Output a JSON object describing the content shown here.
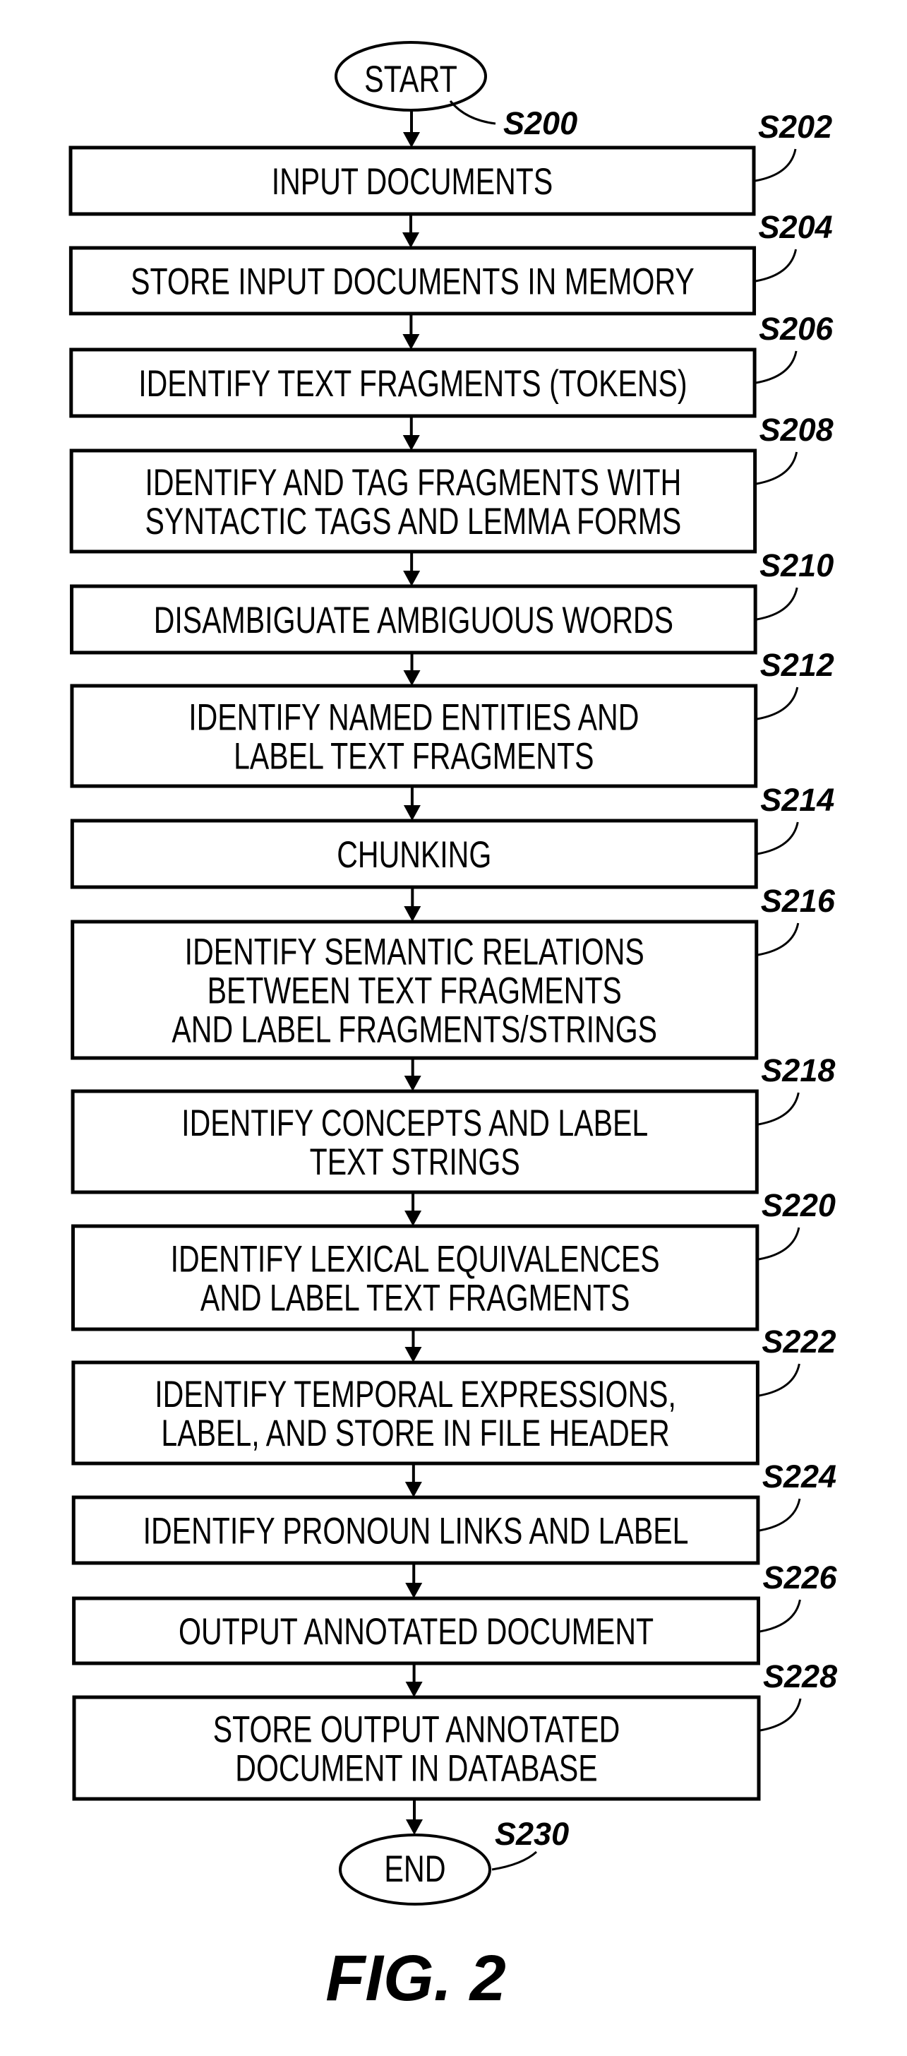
{
  "figure": {
    "title": "FIG. 2"
  },
  "start": {
    "text": "START",
    "ref": "S200"
  },
  "end": {
    "text": "END",
    "ref": "S230"
  },
  "steps": [
    {
      "ref": "S202",
      "lines": [
        "INPUT DOCUMENTS"
      ]
    },
    {
      "ref": "S204",
      "lines": [
        "STORE INPUT DOCUMENTS IN MEMORY"
      ]
    },
    {
      "ref": "S206",
      "lines": [
        "IDENTIFY TEXT FRAGMENTS (TOKENS)"
      ]
    },
    {
      "ref": "S208",
      "lines": [
        "IDENTIFY AND TAG FRAGMENTS WITH",
        "SYNTACTIC TAGS AND LEMMA FORMS"
      ]
    },
    {
      "ref": "S210",
      "lines": [
        "DISAMBIGUATE AMBIGUOUS WORDS"
      ]
    },
    {
      "ref": "S212",
      "lines": [
        "IDENTIFY NAMED ENTITIES AND",
        "LABEL TEXT FRAGMENTS"
      ]
    },
    {
      "ref": "S214",
      "lines": [
        "CHUNKING"
      ]
    },
    {
      "ref": "S216",
      "lines": [
        "IDENTIFY SEMANTIC RELATIONS",
        "BETWEEN TEXT FRAGMENTS",
        "AND LABEL FRAGMENTS/STRINGS"
      ]
    },
    {
      "ref": "S218",
      "lines": [
        "IDENTIFY CONCEPTS AND LABEL",
        "TEXT STRINGS"
      ]
    },
    {
      "ref": "S220",
      "lines": [
        "IDENTIFY LEXICAL EQUIVALENCES",
        "AND LABEL TEXT FRAGMENTS"
      ]
    },
    {
      "ref": "S222",
      "lines": [
        "IDENTIFY TEMPORAL EXPRESSIONS,",
        "LABEL, AND STORE IN FILE HEADER"
      ]
    },
    {
      "ref": "S224",
      "lines": [
        "IDENTIFY PRONOUN LINKS AND LABEL"
      ]
    },
    {
      "ref": "S226",
      "lines": [
        "OUTPUT ANNOTATED DOCUMENT"
      ]
    },
    {
      "ref": "S228",
      "lines": [
        "STORE OUTPUT ANNOTATED",
        "DOCUMENT IN DATABASE"
      ]
    }
  ]
}
